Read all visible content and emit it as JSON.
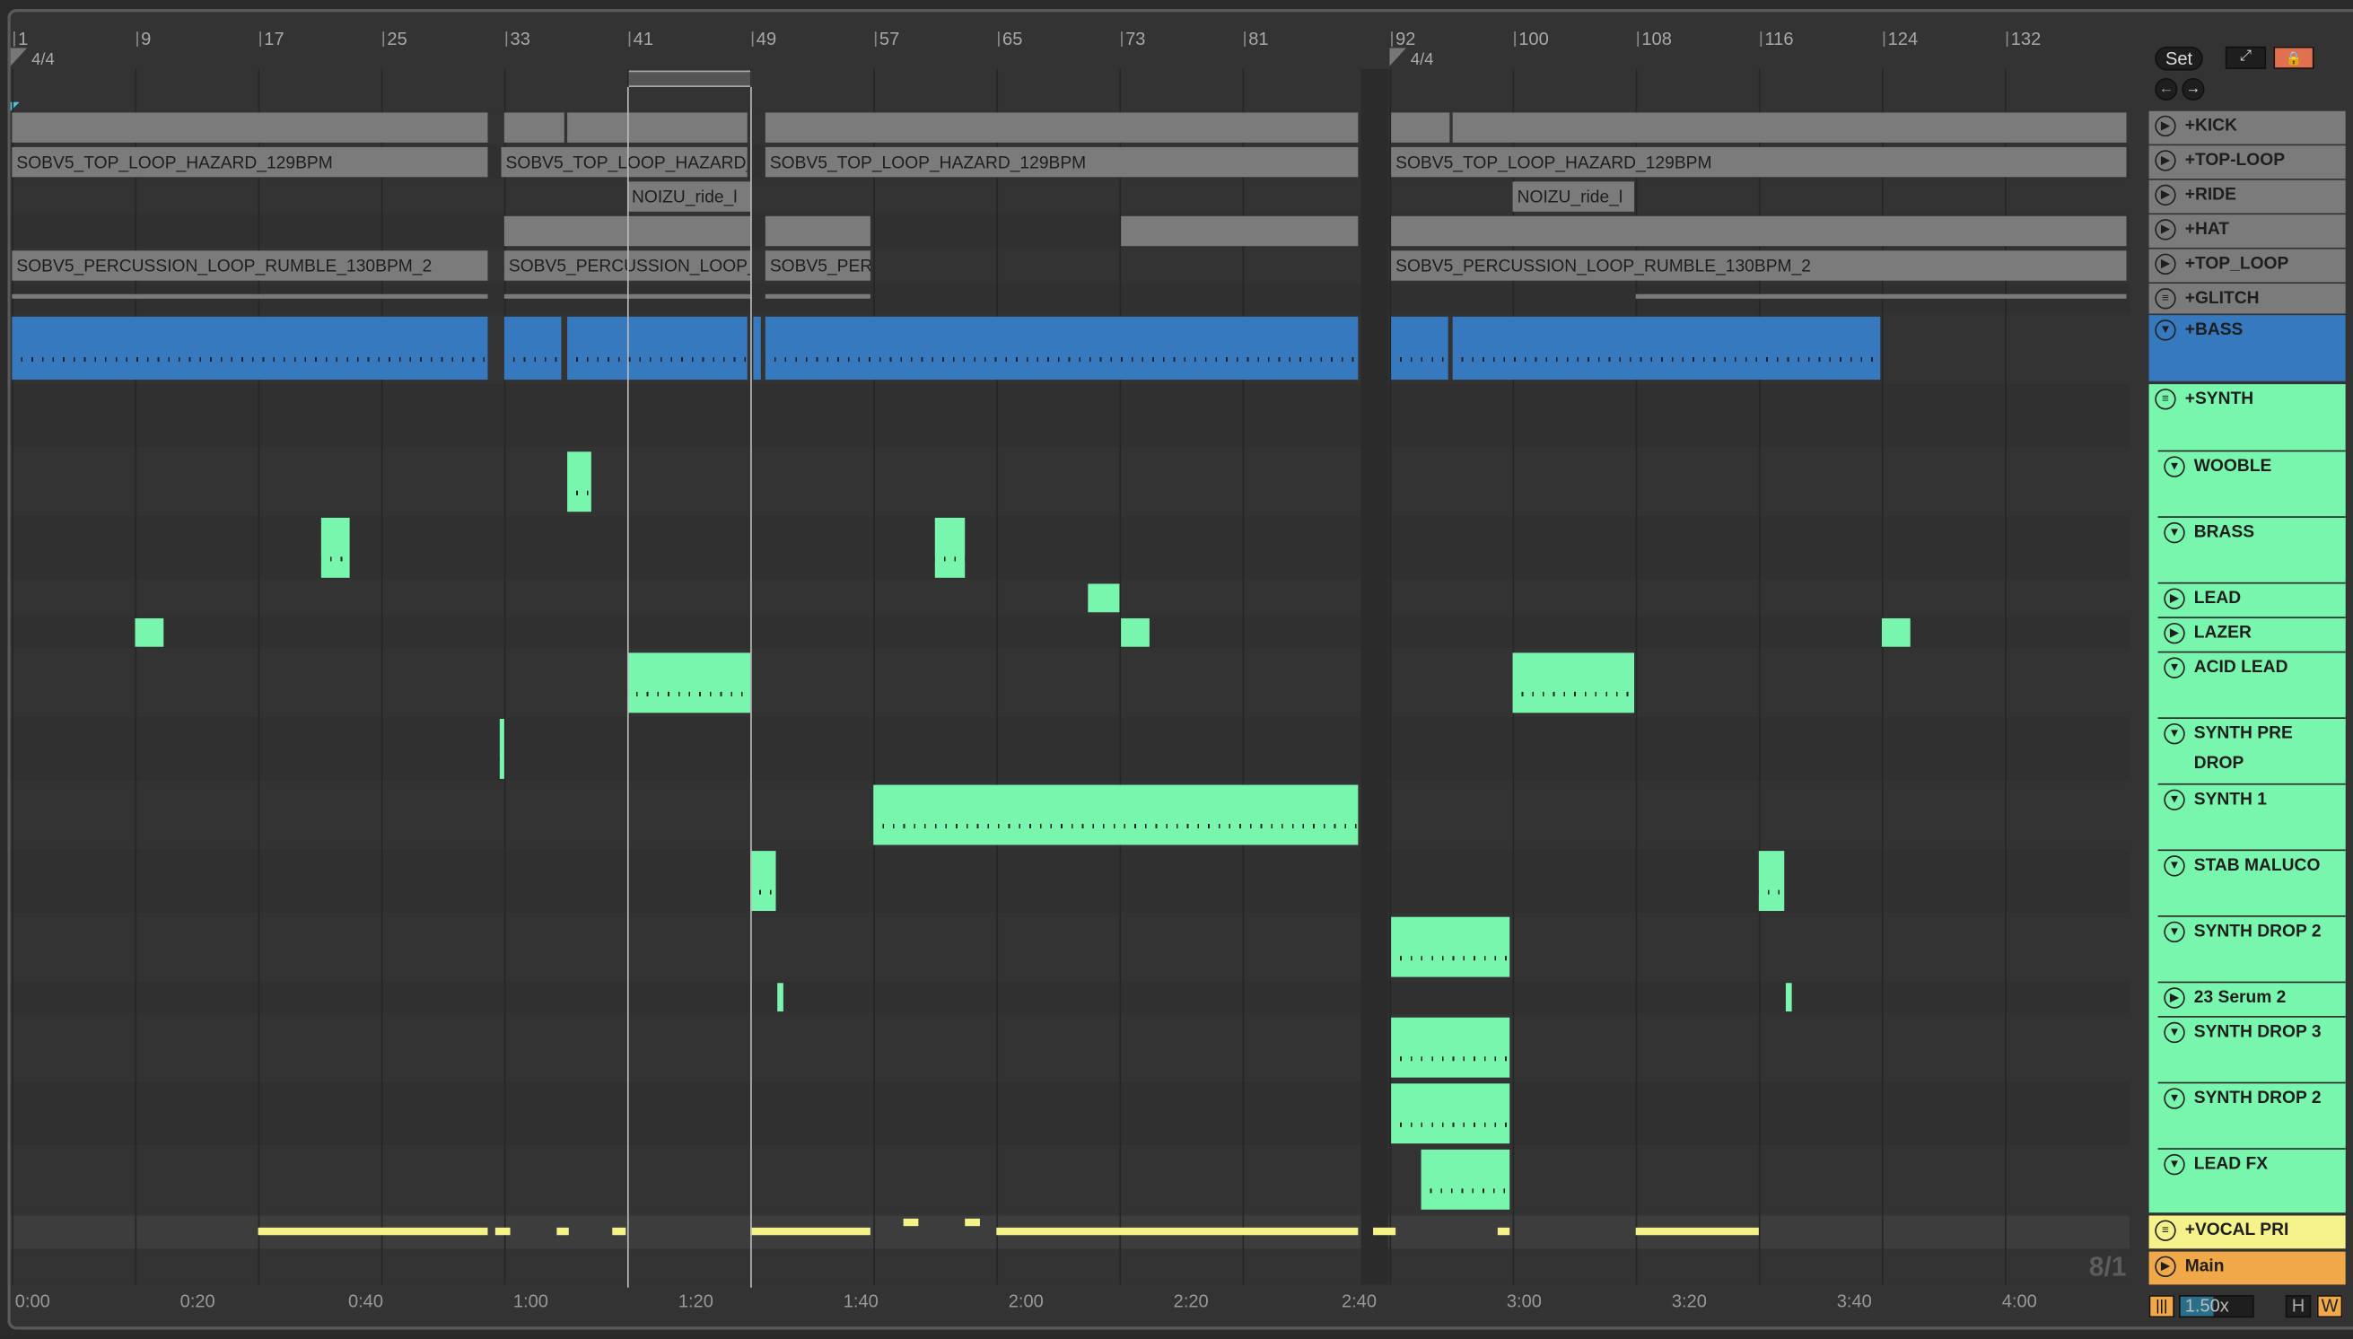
{
  "ruler": {
    "bars": [
      "1",
      "9",
      "17",
      "25",
      "33",
      "41",
      "49",
      "57",
      "65",
      "73",
      "81",
      "92",
      "100",
      "108",
      "116",
      "124",
      "132"
    ],
    "time_signature": "4/4",
    "time_signature_2": "4/4"
  },
  "time_ruler": [
    "0:00",
    "0:20",
    "0:40",
    "1:00",
    "1:20",
    "1:40",
    "2:00",
    "2:20",
    "2:40",
    "3:00",
    "3:20",
    "3:40",
    "4:00"
  ],
  "controls": {
    "set_label": "Set",
    "zoom_value": "1.50x",
    "h_label": "H",
    "w_label": "W",
    "grid_readout": "8/1"
  },
  "clip_names": {
    "top_loop": "SOBV5_TOP_LOOP_HAZARD_129BPM",
    "ride": "NOIZU_ride_l",
    "perc": "SOBV5_PERCUSSION_LOOP_RUMBLE_130BPM_2"
  },
  "tracks": [
    {
      "name": "+KICK",
      "icon": "play"
    },
    {
      "name": "+TOP-LOOP",
      "icon": "play"
    },
    {
      "name": "+RIDE",
      "icon": "play"
    },
    {
      "name": "+HAT",
      "icon": "play"
    },
    {
      "name": "+TOP_LOOP",
      "icon": "play"
    },
    {
      "name": "+GLITCH",
      "icon": "menu"
    },
    {
      "name": "+BASS",
      "icon": "fold"
    },
    {
      "name": "+SYNTH",
      "icon": "menu"
    },
    {
      "name": "WOOBLE",
      "icon": "fold"
    },
    {
      "name": "BRASS",
      "icon": "fold"
    },
    {
      "name": "LEAD",
      "icon": "play"
    },
    {
      "name": "LAZER",
      "icon": "play"
    },
    {
      "name": "ACID LEAD",
      "icon": "fold"
    },
    {
      "name": "SYNTH PRE DROP",
      "icon": "fold"
    },
    {
      "name": "SYNTH 1",
      "icon": "fold"
    },
    {
      "name": "STAB MALUCO",
      "icon": "fold"
    },
    {
      "name": "SYNTH DROP 2",
      "icon": "fold"
    },
    {
      "name": "23 Serum 2",
      "icon": "play"
    },
    {
      "name": "SYNTH DROP 3",
      "icon": "fold"
    },
    {
      "name": "SYNTH DROP 2",
      "icon": "fold"
    },
    {
      "name": "LEAD FX",
      "icon": "fold"
    },
    {
      "name": "+VOCAL PRI",
      "icon": "menu"
    },
    {
      "name": "Main",
      "icon": "play"
    }
  ],
  "colors": {
    "gray": "#7b7b7b",
    "bass": "#3679bf",
    "synth": "#79f6ad",
    "vocal": "#f5f28a",
    "main": "#f0a848",
    "lock": "#e07050"
  }
}
